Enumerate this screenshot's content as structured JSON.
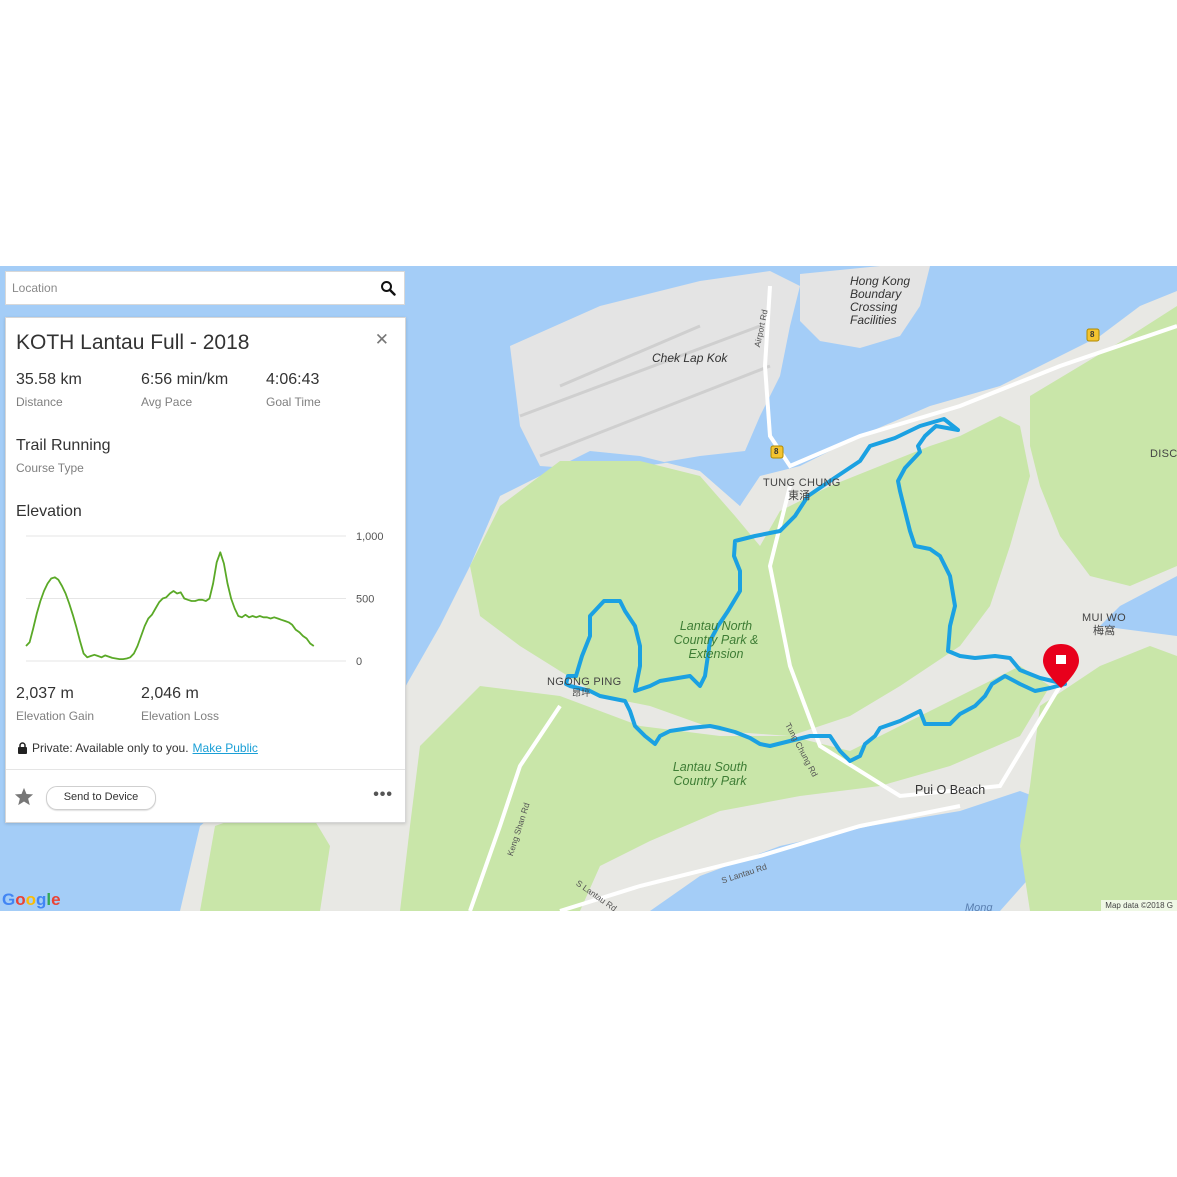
{
  "search": {
    "placeholder": "Location"
  },
  "course": {
    "title": "KOTH Lantau Full - 2018",
    "stats": [
      {
        "value": "35.58 km",
        "label": "Distance"
      },
      {
        "value": "6:56 min/km",
        "label": "Avg Pace"
      },
      {
        "value": "4:06:43",
        "label": "Goal Time"
      }
    ],
    "course_type_value": "Trail Running",
    "course_type_label": "Course Type",
    "elevation_heading": "Elevation",
    "elevation_stats": [
      {
        "value": "2,037 m",
        "label": "Elevation Gain"
      },
      {
        "value": "2,046 m",
        "label": "Elevation Loss"
      }
    ],
    "privacy_text": "Private: Available only to you.",
    "make_public": "Make Public",
    "send_to_device": "Send to Device"
  },
  "chart_data": {
    "type": "line",
    "yticks": [
      "1,000",
      "500",
      "0"
    ],
    "ylim": [
      0,
      1000
    ],
    "xlim": [
      0,
      35.58
    ],
    "color": "#5aa927",
    "x": [
      0,
      0.4,
      0.8,
      1.2,
      1.6,
      2,
      2.4,
      2.8,
      3.2,
      3.6,
      4,
      4.4,
      4.8,
      5.2,
      5.6,
      6,
      6.4,
      6.8,
      7.2,
      7.6,
      8,
      8.4,
      8.8,
      9.2,
      9.6,
      10,
      10.4,
      10.8,
      11.2,
      11.6,
      12,
      12.4,
      12.8,
      13.2,
      13.6,
      14,
      14.4,
      14.8,
      15.2,
      15.6,
      16,
      16.4,
      16.8,
      17.2,
      17.6,
      18,
      18.4,
      18.8,
      19.2,
      19.6,
      20,
      20.4,
      20.8,
      21.2,
      21.6,
      22,
      22.4,
      22.8,
      23.2,
      23.6,
      24,
      24.4,
      24.8,
      25.2,
      25.6,
      26,
      26.4,
      26.8,
      27.2,
      27.6,
      28,
      28.4,
      28.8,
      29.2,
      29.6,
      30,
      30.4,
      30.8,
      31.2,
      31.6,
      32,
      32.4,
      32.8,
      33.2,
      33.6,
      34,
      34.4,
      34.8,
      35.2,
      35.58
    ],
    "y": [
      120,
      150,
      260,
      380,
      480,
      560,
      620,
      660,
      670,
      650,
      600,
      540,
      460,
      370,
      270,
      160,
      60,
      30,
      40,
      50,
      40,
      30,
      45,
      35,
      25,
      20,
      15,
      15,
      20,
      30,
      60,
      120,
      200,
      280,
      340,
      370,
      420,
      470,
      500,
      510,
      540,
      560,
      540,
      550,
      500,
      490,
      480,
      480,
      490,
      490,
      480,
      500,
      620,
      790,
      870,
      780,
      620,
      500,
      420,
      360,
      350,
      370,
      350,
      360,
      350,
      360,
      350,
      350,
      340,
      350,
      340,
      330,
      320,
      310,
      290,
      250,
      230,
      200,
      180,
      140,
      120
    ]
  },
  "map": {
    "labels": {
      "chek_lap_kok": "Chek Lap Kok",
      "hk_boundary": "Hong Kong Boundary Crossing Facilities",
      "tung_chung": "TUNG CHUNG",
      "tung_chung_cn": "東涌",
      "ngong_ping": "NGONG PING",
      "ngong_ping_cn": "昂坪",
      "mui_wo": "MUI WO",
      "mui_wo_cn": "梅窩",
      "lantau_north": "Lantau North Country Park & Extension",
      "lantau_south": "Lantau South Country Park",
      "pui_o": "Pui O Beach",
      "disc": "DISC",
      "airport_rd": "Airport Rd",
      "tung_chung_rd": "Tung Chung Rd",
      "keng_shan_rd": "Keng Shan Rd",
      "s_lantau_rd_1": "S Lantau Rd",
      "s_lantau_rd_2": "S Lantau Rd",
      "route_8_a": "8",
      "route_8_b": "8",
      "mong": "Mong"
    },
    "google": "Google",
    "map_data": "Map data ©2018 G",
    "route_color": "#1ba1e2",
    "marker_color": "#e8001c"
  }
}
